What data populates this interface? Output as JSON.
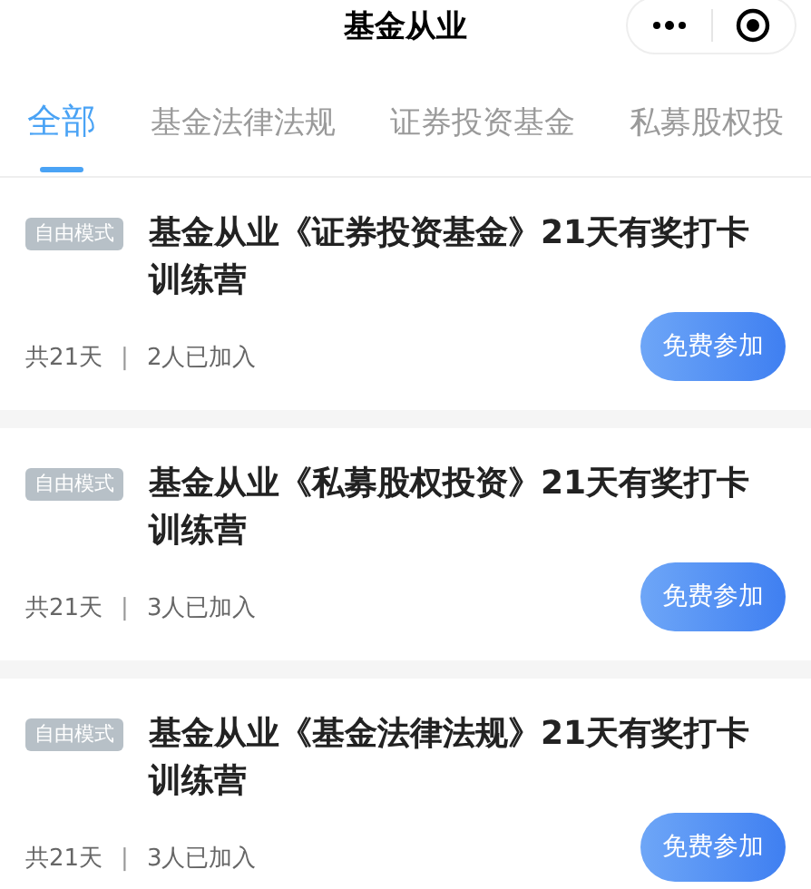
{
  "header": {
    "title": "基金从业"
  },
  "tabs": [
    {
      "label": "全部",
      "selected": true
    },
    {
      "label": "基金法律法规",
      "selected": false
    },
    {
      "label": "证券投资基金",
      "selected": false
    },
    {
      "label": "私募股权投",
      "selected": false
    }
  ],
  "courses": [
    {
      "tag": "自由模式",
      "title": "基金从业《证券投资基金》21天有奖打卡训练营",
      "duration": "共21天",
      "separator": "|",
      "joined": "2人已加入",
      "button": "免费参加"
    },
    {
      "tag": "自由模式",
      "title": "基金从业《私募股权投资》21天有奖打卡训练营",
      "duration": "共21天",
      "separator": "|",
      "joined": "3人已加入",
      "button": "免费参加"
    },
    {
      "tag": "自由模式",
      "title": "基金从业《基金法律法规》21天有奖打卡训练营",
      "duration": "共21天",
      "separator": "|",
      "joined": "3人已加入",
      "button": "免费参加"
    }
  ]
}
